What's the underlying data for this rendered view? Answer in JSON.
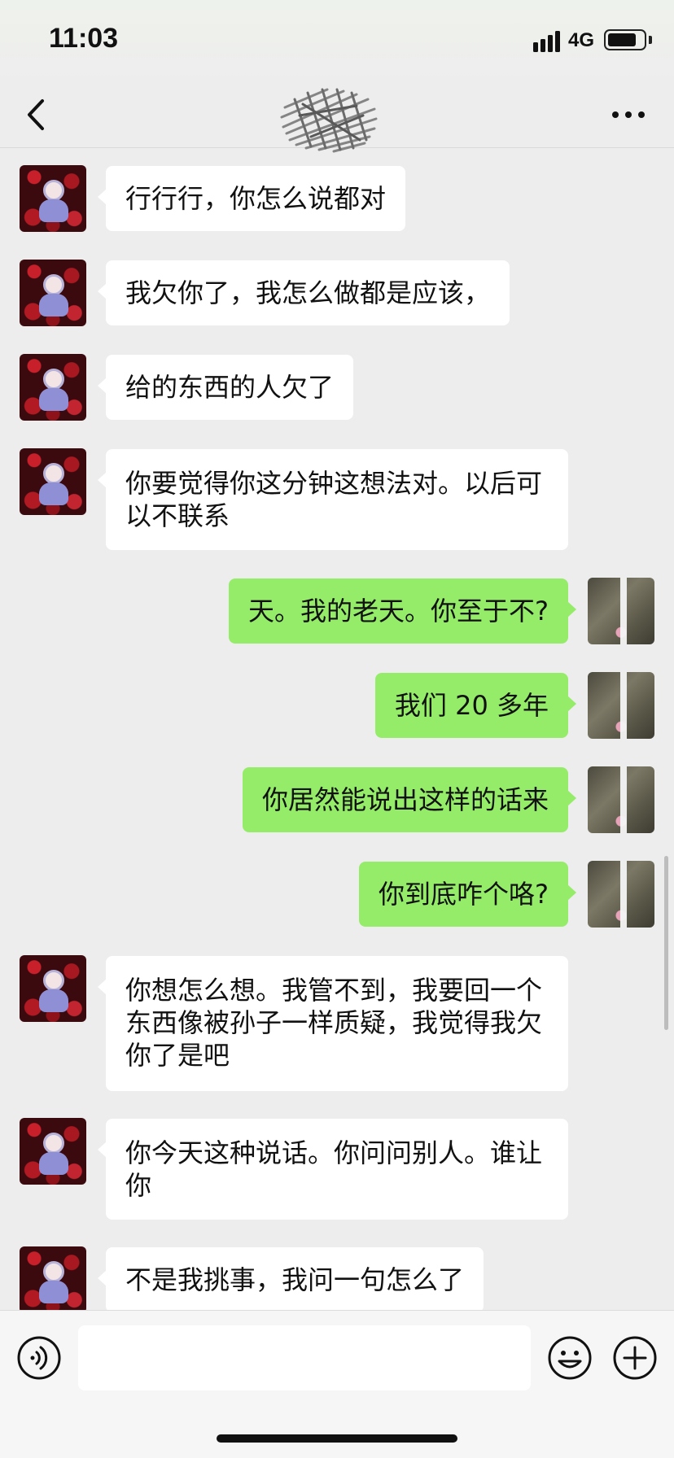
{
  "status_bar": {
    "time": "11:03",
    "network": "4G"
  },
  "nav": {
    "title_obscured": true
  },
  "messages": [
    {
      "side": "left",
      "text": "行行行，你怎么说都对"
    },
    {
      "side": "left",
      "text": "我欠你了，我怎么做都是应该，"
    },
    {
      "side": "left",
      "text": "给的东西的人欠了"
    },
    {
      "side": "left",
      "text": "你要觉得你这分钟这想法对。以后可以不联系"
    },
    {
      "side": "right",
      "text": "天。我的老天。你至于不?"
    },
    {
      "side": "right",
      "text": "我们 20 多年"
    },
    {
      "side": "right",
      "text": "你居然能说出这样的话来"
    },
    {
      "side": "right",
      "text": "你到底咋个咯?"
    },
    {
      "side": "left",
      "text": "你想怎么想。我管不到，我要回一个东西像被孙子一样质疑，我觉得我欠你了是吧"
    },
    {
      "side": "left",
      "text": "你今天这种说话。你问问别人。谁让你"
    },
    {
      "side": "left",
      "text": "不是我挑事，我问一句怎么了"
    }
  ],
  "input": {
    "value": "",
    "placeholder": ""
  },
  "icons": {
    "back": "chevron-left-icon",
    "more": "more-dots-icon",
    "voice": "voice-icon",
    "emoji": "emoji-icon",
    "plus": "plus-icon"
  },
  "colors": {
    "background": "#ededed",
    "bubble_incoming": "#ffffff",
    "bubble_outgoing": "#95ec69",
    "text": "#111111"
  }
}
